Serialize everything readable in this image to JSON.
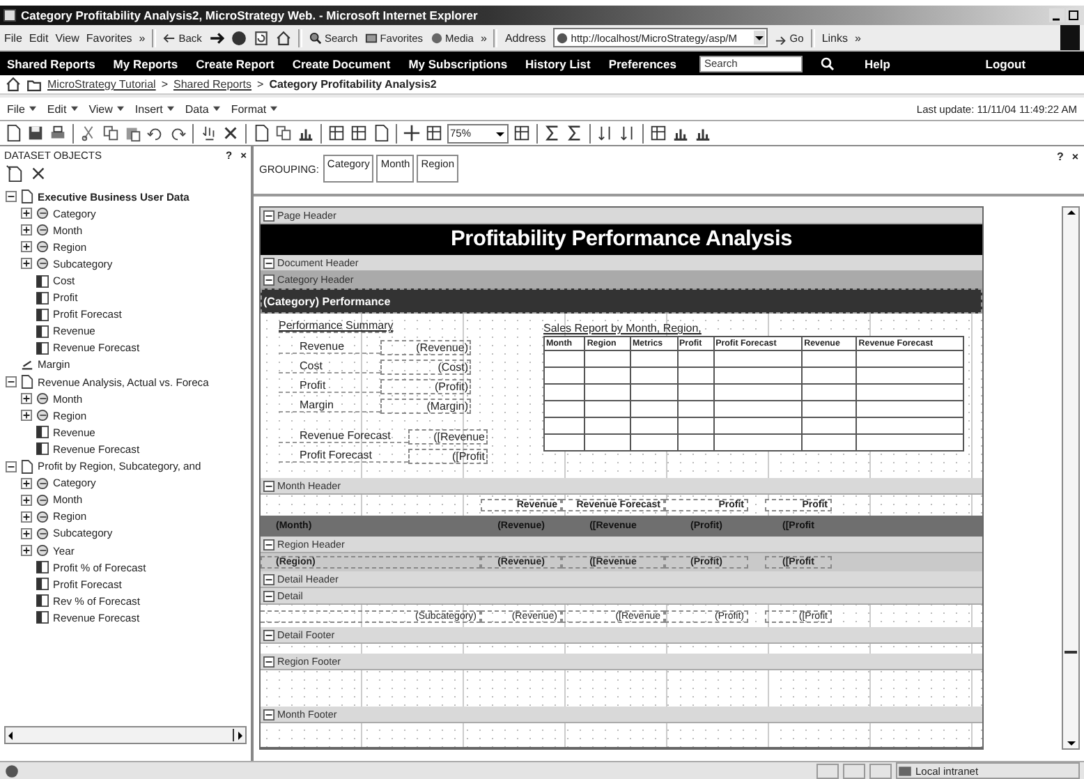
{
  "window": {
    "title": "Category Profitability Analysis2, MicroStrategy Web. - Microsoft Internet Explorer"
  },
  "browser_menu": [
    "File",
    "Edit",
    "View",
    "Favorites",
    "»"
  ],
  "browser_toolbar": {
    "back": "Back",
    "search": "Search",
    "favorites": "Favorites",
    "media": "Media",
    "more": "»",
    "address_label": "Address",
    "address": "http://localhost/MicroStrategy/asp/M",
    "go": "Go",
    "links": "Links",
    "links_more": "»"
  },
  "nav": {
    "items": [
      "Shared Reports",
      "My Reports",
      "Create Report",
      "Create Document",
      "My Subscriptions",
      "History List",
      "Preferences"
    ],
    "search_placeholder": "Search",
    "right_items": [
      "Help",
      "Logout"
    ]
  },
  "breadcrumb": {
    "separator": ">",
    "items": [
      {
        "label": "MicroStrategy Tutorial",
        "link": true
      },
      {
        "label": "Shared Reports",
        "link": true
      },
      {
        "label": "Category Profitability Analysis2",
        "link": false
      }
    ]
  },
  "editor_menu": [
    "File",
    "Edit",
    "View",
    "Insert",
    "Data",
    "Format"
  ],
  "last_update": "Last update: 11/11/04 11:49:22 AM",
  "zoom": "75%",
  "dataset_panel": {
    "title": "DATASET OBJECTS",
    "help": "?",
    "close": "×",
    "datasets": [
      {
        "label": "Executive Business User Data",
        "primary": true,
        "expanded": true,
        "children": [
          {
            "kind": "attribute",
            "label": "Category",
            "expanded": false
          },
          {
            "kind": "attribute",
            "label": "Month",
            "expanded": false
          },
          {
            "kind": "attribute",
            "label": "Region",
            "expanded": false
          },
          {
            "kind": "attribute",
            "label": "Subcategory",
            "expanded": false
          },
          {
            "kind": "metric",
            "label": "Cost"
          },
          {
            "kind": "metric",
            "label": "Profit"
          },
          {
            "kind": "metric",
            "label": "Profit Forecast"
          },
          {
            "kind": "metric",
            "label": "Revenue"
          },
          {
            "kind": "metric",
            "label": "Revenue Forecast"
          },
          {
            "kind": "derived",
            "label": "Margin"
          }
        ]
      },
      {
        "label": "Revenue Analysis, Actual vs. Foreca",
        "primary": false,
        "expanded": true,
        "children": [
          {
            "kind": "attribute",
            "label": "Month",
            "expanded": false
          },
          {
            "kind": "attribute",
            "label": "Region",
            "expanded": false
          },
          {
            "kind": "metric",
            "label": "Revenue"
          },
          {
            "kind": "metric",
            "label": "Revenue Forecast"
          }
        ]
      },
      {
        "label": "Profit by Region, Subcategory, and",
        "primary": false,
        "expanded": true,
        "children": [
          {
            "kind": "attribute",
            "label": "Category",
            "expanded": false
          },
          {
            "kind": "attribute",
            "label": "Month",
            "expanded": false
          },
          {
            "kind": "attribute",
            "label": "Region",
            "expanded": false
          },
          {
            "kind": "attribute",
            "label": "Subcategory",
            "expanded": false
          },
          {
            "kind": "attribute",
            "label": "Year",
            "expanded": false
          },
          {
            "kind": "metric",
            "label": "Profit % of Forecast"
          },
          {
            "kind": "metric",
            "label": "Profit Forecast"
          },
          {
            "kind": "metric",
            "label": "Rev % of Forecast"
          },
          {
            "kind": "metric",
            "label": "Revenue Forecast"
          }
        ]
      }
    ]
  },
  "grouping": {
    "label": "GROUPING:",
    "items": [
      "Category",
      "Month",
      "Region"
    ],
    "help": "?",
    "close": "×"
  },
  "report": {
    "sections": [
      {
        "kind": "band",
        "label": "Page Header"
      },
      {
        "kind": "title",
        "text": "Profitability Performance Analysis"
      },
      {
        "kind": "band",
        "label": "Document Header"
      },
      {
        "kind": "band-dark",
        "label": "Category Header"
      },
      {
        "kind": "heading",
        "text": "(Category) Performance"
      },
      {
        "kind": "summary",
        "title": "Performance Summary",
        "rows": [
          {
            "label": "Revenue",
            "field": "(Revenue)"
          },
          {
            "label": "Cost",
            "field": "(Cost)"
          },
          {
            "label": "Profit",
            "field": "(Profit)"
          },
          {
            "label": "Margin",
            "field": "(Margin)"
          }
        ],
        "forecast_rows": [
          {
            "label": "Revenue Forecast",
            "field": "([Revenue"
          },
          {
            "label": "Profit Forecast",
            "field": "([Profit"
          }
        ],
        "grid_title": "Sales Report by Month, Region,",
        "grid_columns": [
          "Month",
          "Region",
          "Metrics",
          "Profit",
          "Profit Forecast",
          "Revenue",
          "Revenue Forecast"
        ]
      },
      {
        "kind": "band",
        "label": "Month Header"
      },
      {
        "kind": "header-row",
        "cells": [
          "Revenue",
          "Revenue Forecast",
          "Profit",
          "Profit"
        ]
      },
      {
        "kind": "month-row",
        "cells": [
          "(Month)",
          "(Revenue)",
          "([Revenue",
          "(Profit)",
          "([Profit"
        ]
      },
      {
        "kind": "band",
        "label": "Region Header"
      },
      {
        "kind": "region-row",
        "cells": [
          "(Region)",
          "(Revenue)",
          "([Revenue",
          "(Profit)",
          "([Profit"
        ]
      },
      {
        "kind": "band",
        "label": "Detail Header"
      },
      {
        "kind": "band",
        "label": "Detail"
      },
      {
        "kind": "detail-row",
        "cells": [
          "(Subcategory)",
          "(Revenue)",
          "([Revenue",
          "(Profit)",
          "([Profit"
        ]
      },
      {
        "kind": "band",
        "label": "Detail Footer"
      },
      {
        "kind": "blank"
      },
      {
        "kind": "band",
        "label": "Region Footer"
      },
      {
        "kind": "blank-tall"
      },
      {
        "kind": "band",
        "label": "Month Footer"
      },
      {
        "kind": "blank"
      }
    ]
  },
  "status_bar": {
    "zone": "Local intranet"
  }
}
